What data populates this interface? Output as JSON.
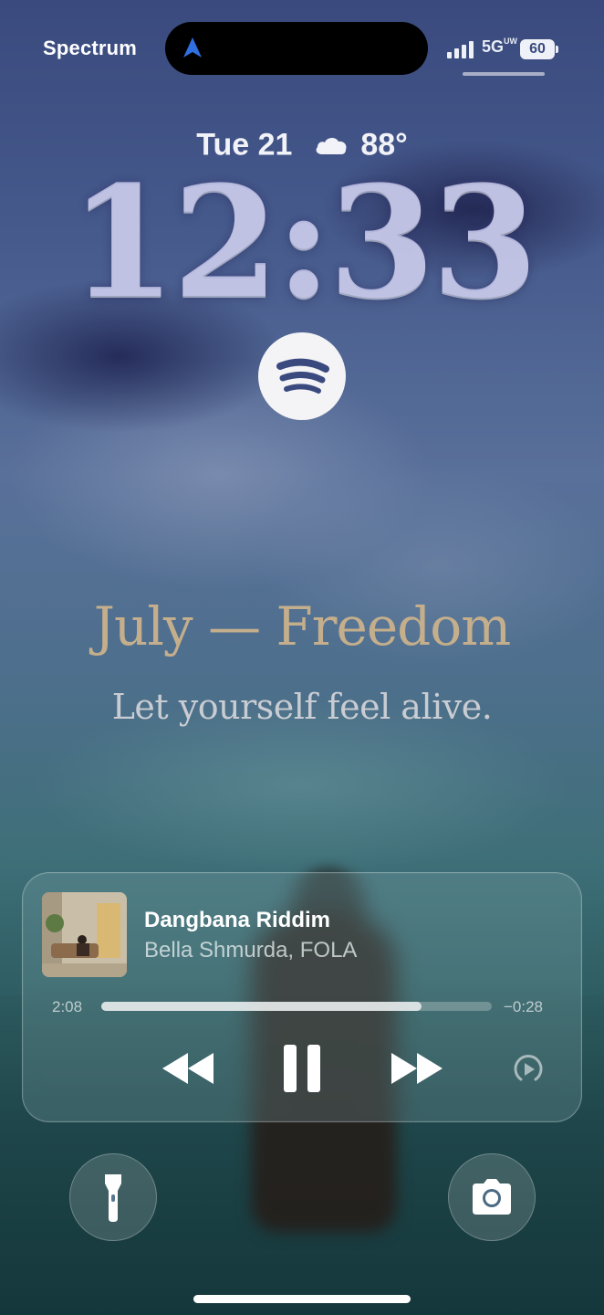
{
  "status_bar": {
    "carrier": "Spectrum",
    "network": "5G",
    "network_sub": "UW",
    "battery": "60"
  },
  "lock_screen": {
    "date": "Tue 21",
    "weather_icon": "cloud-icon",
    "temperature": "88°",
    "time": "12:33",
    "app_widget_icon": "spotify-icon"
  },
  "wallpaper_text": {
    "title": "July — Freedom",
    "subtitle": "Let yourself feel alive."
  },
  "now_playing": {
    "track": "Dangbana Riddim",
    "artist": "Bella Shmurda, FOLA",
    "elapsed": "2:08",
    "remaining": "−0:28",
    "progress_fraction": 0.82
  },
  "colors": {
    "accent_nav": "#2f6fe0",
    "spotify_bg": "#f4f4f6",
    "quote_title": "#c4ae8c"
  },
  "quick_actions": {
    "left": "flashlight-icon",
    "right": "camera-icon"
  }
}
